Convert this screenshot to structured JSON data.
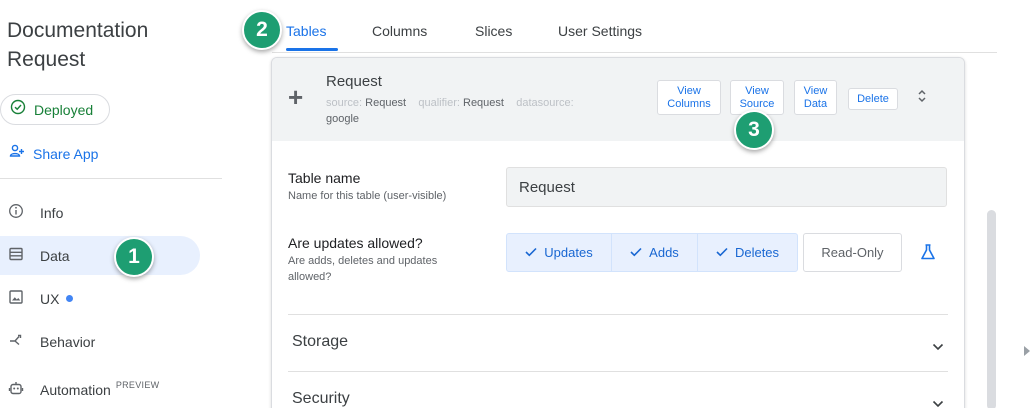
{
  "app": {
    "title_line1": "Documentation",
    "title_line2": "Request"
  },
  "sidebar": {
    "status": "Deployed",
    "share": "Share App",
    "items": [
      {
        "label": "Info",
        "icon": "info-icon"
      },
      {
        "label": "Data",
        "icon": "table-icon",
        "active": true
      },
      {
        "label": "UX",
        "icon": "image-icon",
        "dot": true
      },
      {
        "label": "Behavior",
        "icon": "flow-icon"
      },
      {
        "label": "Automation",
        "icon": "robot-icon",
        "tag": "PREVIEW"
      }
    ]
  },
  "tabs": [
    {
      "label": "Tables",
      "active": true
    },
    {
      "label": "Columns"
    },
    {
      "label": "Slices"
    },
    {
      "label": "User Settings"
    }
  ],
  "table": {
    "name": "Request",
    "source_key": "source:",
    "source_val": "Request",
    "qualifier_key": "qualifier:",
    "qualifier_val": "Request",
    "datasource_key": "datasource:",
    "datasource_val": "google",
    "buttons": {
      "view_columns": [
        "View",
        "Columns"
      ],
      "view_source": [
        "View",
        "Source"
      ],
      "view_data": [
        "View",
        "Data"
      ],
      "delete": "Delete"
    }
  },
  "form": {
    "table_name_label": "Table name",
    "table_name_help": "Name for this table (user-visible)",
    "table_name_value": "Request",
    "updates_label": "Are updates allowed?",
    "updates_help_1": "Are adds, deletes and updates",
    "updates_help_2": "allowed?",
    "options": [
      "Updates",
      "Adds",
      "Deletes"
    ],
    "readonly": "Read-Only"
  },
  "sections": [
    "Storage",
    "Security"
  ],
  "markers": [
    "1",
    "2",
    "3"
  ],
  "colors": {
    "accent": "#1a73e8",
    "deployed": "#188038",
    "marker": "#1e9e72"
  }
}
